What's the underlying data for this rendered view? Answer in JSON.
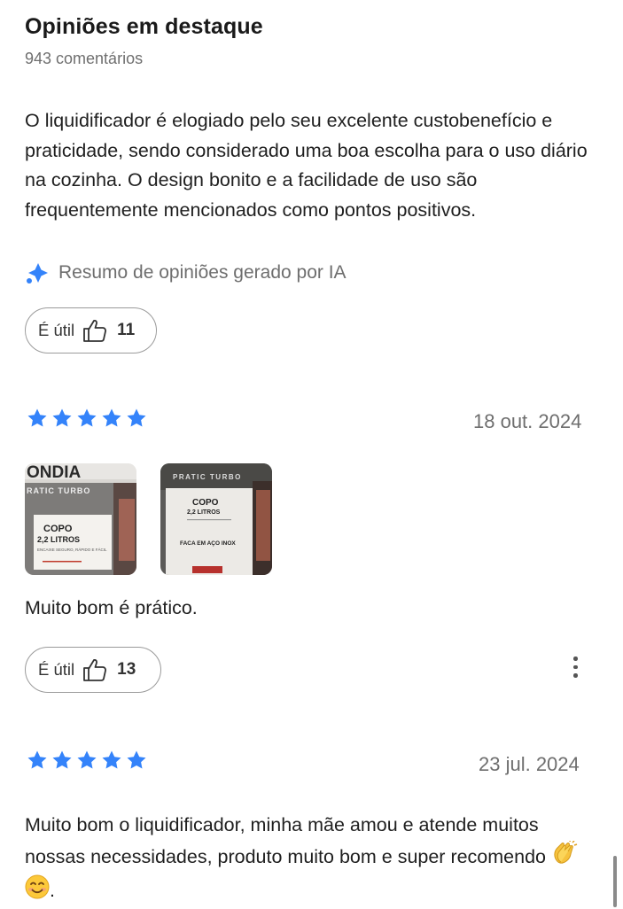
{
  "header": {
    "title": "Opiniões em destaque",
    "comments_count": "943 comentários"
  },
  "summary": {
    "text": "O liquidificador é elogiado pelo seu excelente custobenefício e praticidade, sendo considerado uma boa escolha para o uso diário na cozinha. O design bonito e a facilidade de uso são frequentemente mencionados como pontos positivos.",
    "ai_label": "Resumo de opiniões gerado por IA",
    "ai_icon": "sparkle-icon",
    "useful_label": "É útil",
    "useful_count": "11"
  },
  "reviews": [
    {
      "rating": 5,
      "date": "18 out. 2024",
      "photos": [
        {
          "brand": "ONDIA",
          "product": "RATIC TURBO",
          "line1": "COPO",
          "line2": "2,2 LITROS",
          "line3": "ENCAIXE SEGURO, RÁPIDO E FÁCIL"
        },
        {
          "brand": "",
          "product": "PRATIC TURBO",
          "line1": "COPO",
          "line2": "2,2 LITROS",
          "line3": "FACA EM AÇO INOX"
        }
      ],
      "text": "Muito bom é prático.",
      "useful_label": "É útil",
      "useful_count": "13"
    },
    {
      "rating": 5,
      "date": "23 jul. 2024",
      "text": "Muito bom o liquidificador, minha mãe amou e atende muitos nossas necessidades, produto muito bom e super recomendo",
      "text_end": "."
    }
  ],
  "colors": {
    "star": "#3483fa",
    "ai_icon": "#3483fa",
    "text": "#1f1f1f",
    "muted": "#6e6e6e"
  }
}
